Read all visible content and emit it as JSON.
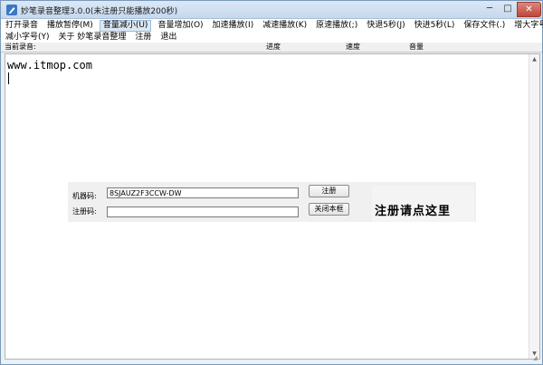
{
  "window": {
    "title": "妙笔录音整理3.0.0(未注册只能播放200秒)",
    "controls": {
      "minimize": "─",
      "maximize": "□",
      "close": "✕"
    }
  },
  "menu": {
    "row1": [
      {
        "label": "打开录音"
      },
      {
        "label": "播放暂停(M)"
      },
      {
        "label": "音量减小(U)",
        "active": true
      },
      {
        "label": "音量增加(O)"
      },
      {
        "label": "加速播放(I)"
      },
      {
        "label": "减速播放(K)"
      },
      {
        "label": "原速播放(;)"
      },
      {
        "label": "快退5秒(J)"
      },
      {
        "label": "快进5秒(L)"
      },
      {
        "label": "保存文件(.)"
      },
      {
        "label": "增大字号(T)"
      }
    ],
    "row2": [
      {
        "label": "减小字号(Y)"
      },
      {
        "label": "关于 妙笔录音整理"
      },
      {
        "label": "注册"
      },
      {
        "label": "退出"
      }
    ]
  },
  "header": {
    "current_recording": "当前录音:",
    "progress": "进度",
    "speed": "速度",
    "volume": "音量"
  },
  "editor": {
    "text": "www.itmop.com"
  },
  "registration": {
    "machine_code_label": "机器码:",
    "machine_code_value": "8SJAUZ2F3CCW-DW",
    "reg_code_label": "注册码:",
    "reg_code_value": "",
    "register_button": "注册",
    "close_button": "关闭本框",
    "register_link": "注册请点这里"
  },
  "colors": {
    "window_bg": "#e8f0f8",
    "titlebar": "#c6d8ee",
    "close_button": "#c4453a",
    "panel_bg": "#f0f0f0"
  }
}
